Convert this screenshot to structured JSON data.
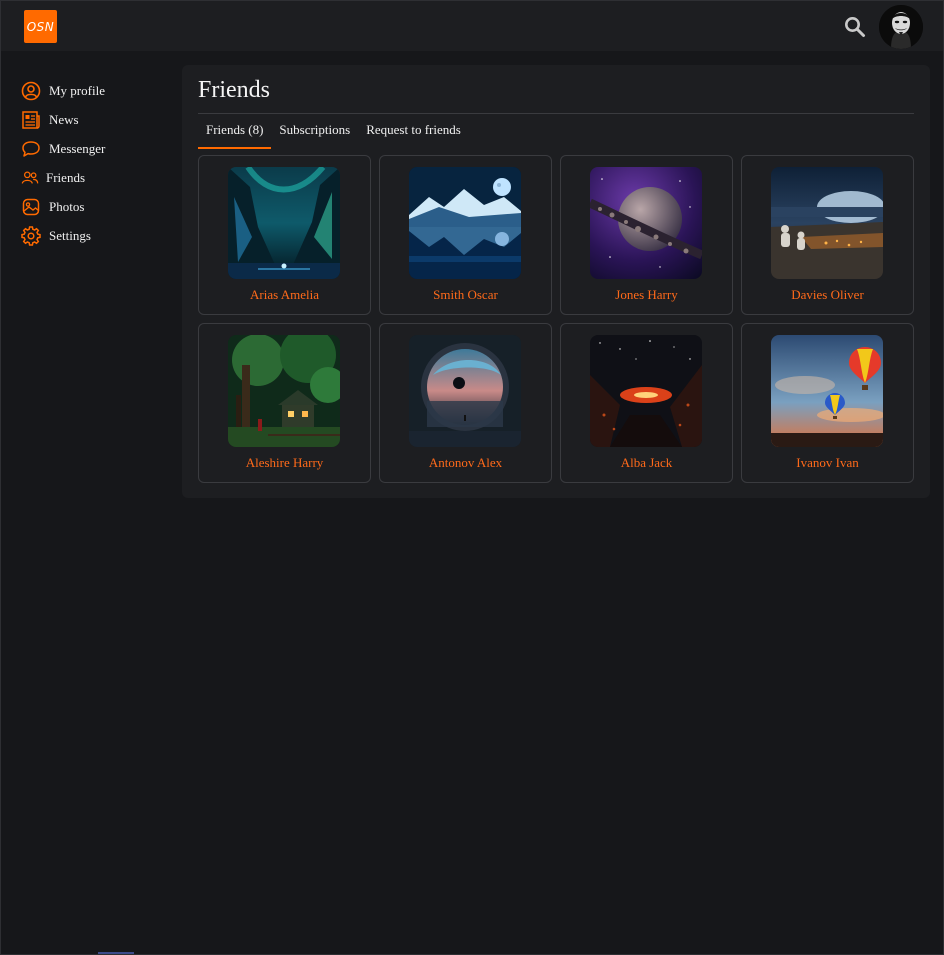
{
  "header": {
    "logo_text": "OSN",
    "search_icon": "search-icon",
    "avatar_icon": "masked-avatar"
  },
  "sidebar": {
    "items": [
      {
        "label": "My profile",
        "icon": "user-circle-icon"
      },
      {
        "label": "News",
        "icon": "newspaper-icon"
      },
      {
        "label": "Messenger",
        "icon": "chat-bubble-icon"
      },
      {
        "label": "Friends",
        "icon": "users-icon"
      },
      {
        "label": "Photos",
        "icon": "image-icon"
      },
      {
        "label": "Settings",
        "icon": "gear-icon"
      }
    ]
  },
  "main": {
    "title": "Friends",
    "tabs": [
      {
        "label": "Friends (8)",
        "active": true
      },
      {
        "label": "Subscriptions",
        "active": false
      },
      {
        "label": "Request to friends",
        "active": false
      }
    ],
    "friends": [
      {
        "name": "Arias Amelia",
        "photo": "aurora-valley"
      },
      {
        "name": "Smith Oscar",
        "photo": "moon-lake"
      },
      {
        "name": "Jones Harry",
        "photo": "planet-asteroids"
      },
      {
        "name": "Davies Oliver",
        "photo": "astronauts-camp"
      },
      {
        "name": "Aleshire Harry",
        "photo": "forest-cabin"
      },
      {
        "name": "Antonov Alex",
        "photo": "portal-planet"
      },
      {
        "name": "Alba Jack",
        "photo": "volcanic-glow"
      },
      {
        "name": "Ivanov Ivan",
        "photo": "hot-air-balloons"
      }
    ]
  },
  "colors": {
    "accent": "#ff6a00",
    "background": "#16171a",
    "panel": "#1d1e21",
    "name_text": "#ff6a1a"
  }
}
